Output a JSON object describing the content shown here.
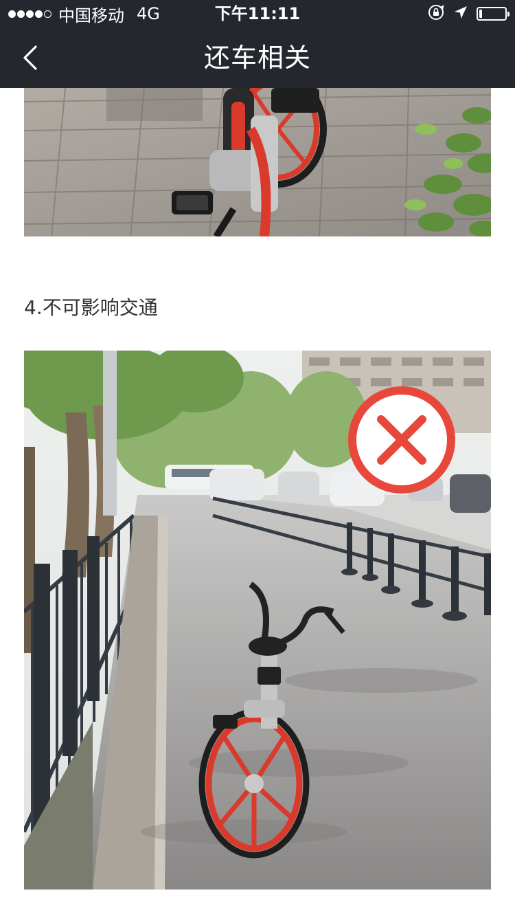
{
  "status_bar": {
    "carrier": "中国移动",
    "network": "4G",
    "time": "下午11:11",
    "signal_bars_filled": 4,
    "signal_bars_total": 5,
    "battery_level": 0.12,
    "icons": [
      "orientation-lock-icon",
      "location-arrow-icon",
      "battery-icon"
    ]
  },
  "nav": {
    "title": "还车相关",
    "back_icon": "chevron-left-icon"
  },
  "content": {
    "step_caption": "4.不可影响交通",
    "photos": [
      {
        "subject": "parked-bike-on-pavement"
      },
      {
        "subject": "bike-blocking-bike-lane",
        "overlay_icon": "forbidden-x-icon"
      }
    ]
  },
  "colors": {
    "navbar_bg": "#24272e",
    "accent_red": "#e8473b",
    "bike_red": "#d93a2b",
    "text_dark": "#333333"
  }
}
